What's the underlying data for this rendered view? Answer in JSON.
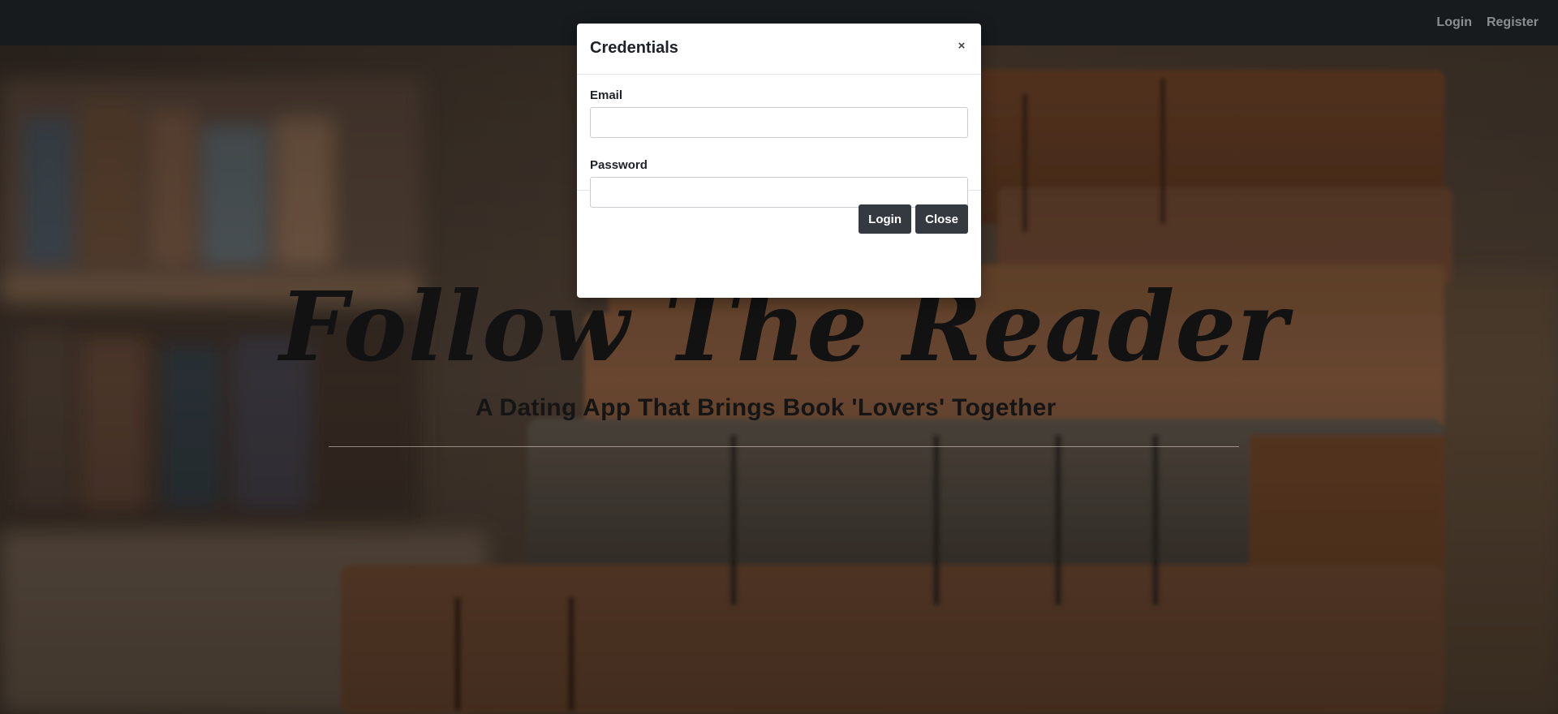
{
  "navbar": {
    "links": [
      {
        "label": "Login"
      },
      {
        "label": "Register"
      }
    ]
  },
  "hero": {
    "title": "Follow The Reader",
    "subtitle": "A Dating App That Brings Book 'Lovers' Together"
  },
  "modal": {
    "title": "Credentials",
    "close_icon": "×",
    "fields": [
      {
        "label": "Email",
        "value": "",
        "placeholder": ""
      },
      {
        "label": "Password",
        "value": "",
        "placeholder": ""
      }
    ],
    "buttons": {
      "login_label": "Login",
      "close_label": "Close"
    }
  },
  "colors": {
    "navbar_bg": "#171b1e",
    "button_bg": "#343a40",
    "nav_link": "#8a8e92"
  }
}
